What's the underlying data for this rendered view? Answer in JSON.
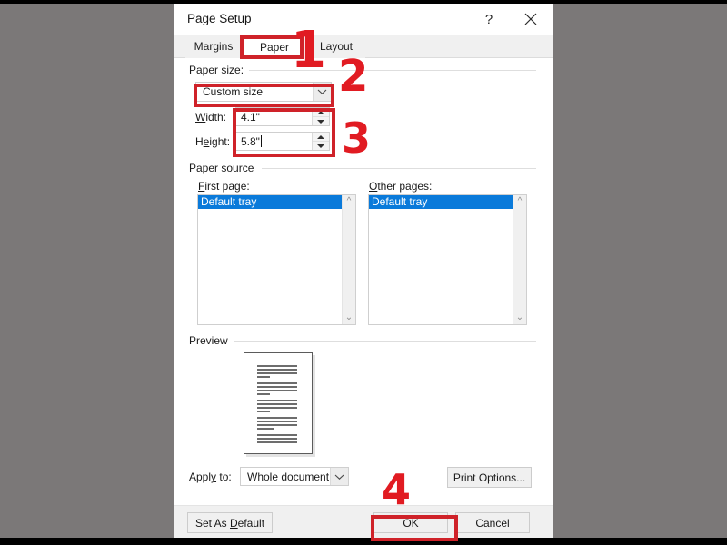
{
  "window": {
    "title": "Page Setup",
    "help_icon": "?",
    "close_icon": "close-icon"
  },
  "tabs": [
    {
      "label": "Margins",
      "selected": false
    },
    {
      "label": "Paper",
      "selected": true
    },
    {
      "label": "Layout",
      "selected": false
    }
  ],
  "paper_size": {
    "group_label": "Paper size:",
    "selected": "Custom size",
    "width": {
      "label": "Width:",
      "value": "4.1\""
    },
    "height": {
      "label": "Height:",
      "value": "5.8\""
    }
  },
  "paper_source": {
    "group_label": "Paper source",
    "first_page": {
      "label": "First page:",
      "items": [
        "Default tray"
      ],
      "selected": "Default tray"
    },
    "other_pages": {
      "label": "Other pages:",
      "items": [
        "Default tray"
      ],
      "selected": "Default tray"
    }
  },
  "preview": {
    "group_label": "Preview"
  },
  "apply": {
    "label": "Apply to:",
    "value": "Whole document",
    "print_options_label": "Print Options..."
  },
  "footer": {
    "set_as_default": "Set As Default",
    "ok": "OK",
    "cancel": "Cancel"
  },
  "annotations": {
    "accent_color": "#e11b22",
    "box_color": "#cf2229",
    "steps": [
      {
        "number": "1",
        "target": "paper-tab"
      },
      {
        "number": "2",
        "target": "paper-size-combo"
      },
      {
        "number": "3",
        "target": "width-height-fields"
      },
      {
        "number": "4",
        "target": "ok-button"
      }
    ]
  }
}
